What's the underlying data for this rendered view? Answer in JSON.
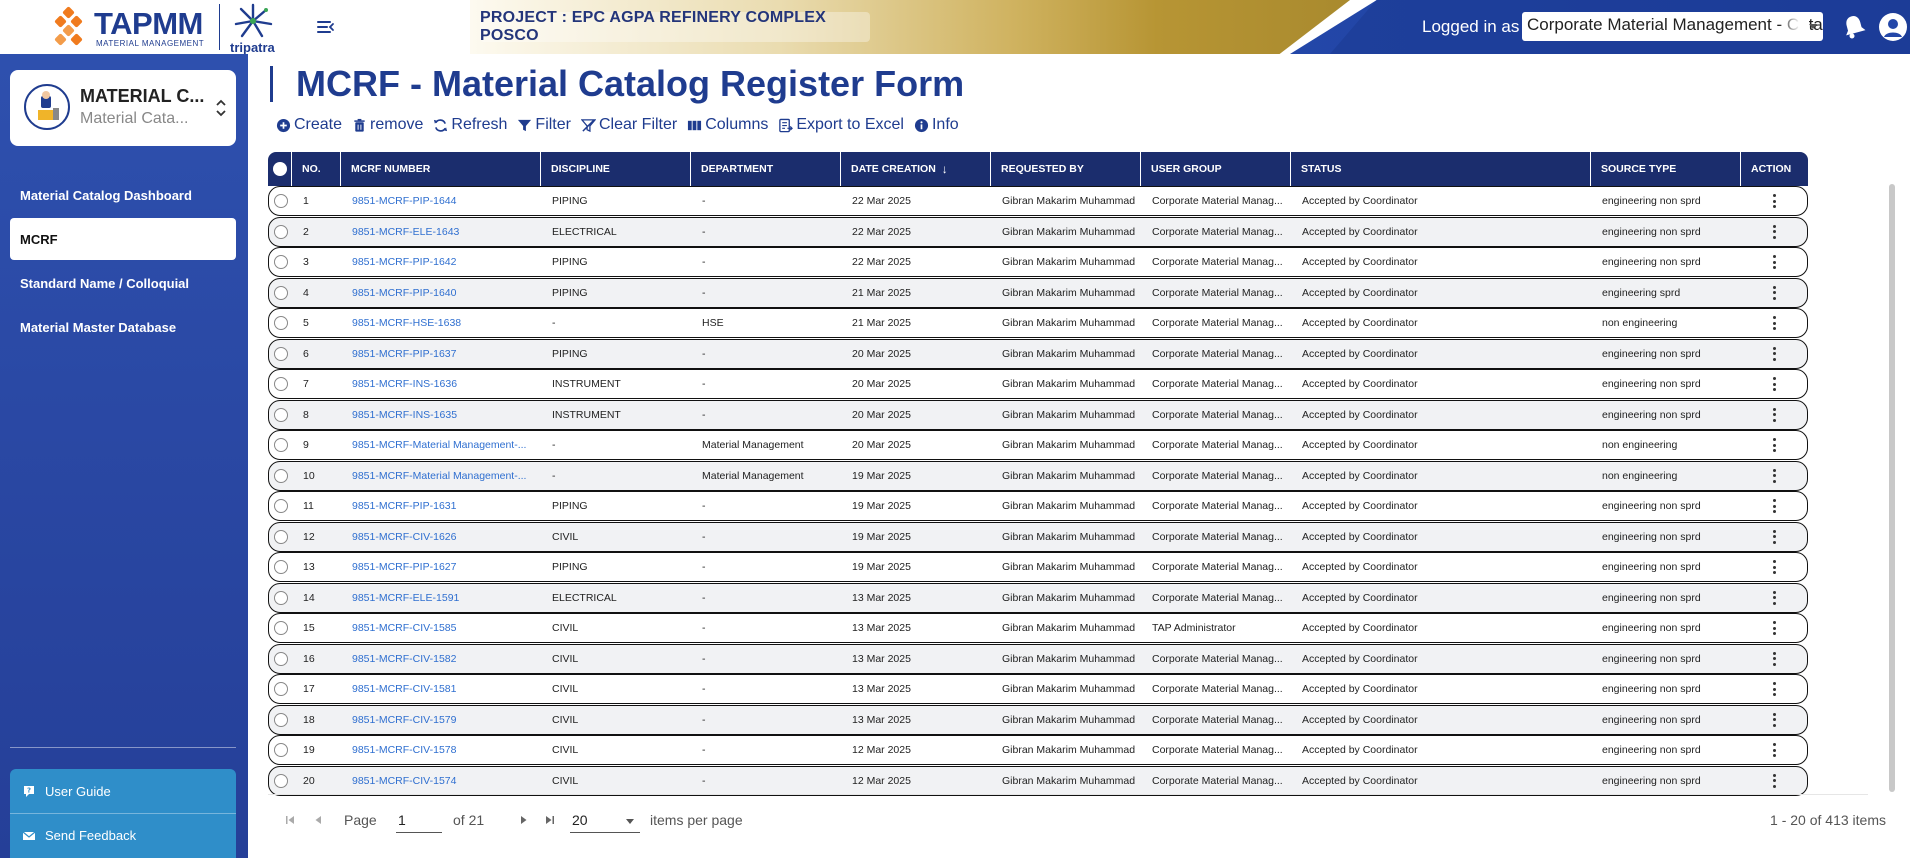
{
  "header": {
    "brand": "TAPMM",
    "brand_sub": "MATERIAL MANAGEMENT",
    "partner": "tripatra",
    "project": "PROJECT : EPC AGPA REFINERY COMPLEX POSCO",
    "logged_in_label": "Logged in as",
    "role": "Corporate Material Management - Catalog"
  },
  "sidebar": {
    "app_title": "MATERIAL C...",
    "app_subtitle": "Material Cata...",
    "items": [
      {
        "label": "Material Catalog Dashboard"
      },
      {
        "label": "MCRF"
      },
      {
        "label": "Standard Name / Colloquial"
      },
      {
        "label": "Material Master Database"
      }
    ],
    "footer": [
      {
        "label": "User Guide"
      },
      {
        "label": "Send Feedback"
      }
    ]
  },
  "main": {
    "title": "MCRF - Material Catalog Register Form",
    "toolbar": {
      "create": "Create",
      "remove": "remove",
      "refresh": "Refresh",
      "filter": "Filter",
      "clear_filter": "Clear Filter",
      "columns": "Columns",
      "export": "Export to Excel",
      "info": "Info"
    }
  },
  "table": {
    "columns": [
      "NO.",
      "MCRF NUMBER",
      "DISCIPLINE",
      "DEPARTMENT",
      "DATE CREATION",
      "REQUESTED BY",
      "USER GROUP",
      "STATUS",
      "SOURCE TYPE",
      "ACTION"
    ],
    "rows": [
      [
        "1",
        "9851-MCRF-PIP-1644",
        "PIPING",
        "-",
        "22 Mar 2025",
        "Gibran Makarim Muhammad",
        "Corporate Material Manag...",
        "Accepted by Coordinator",
        "engineering non sprd"
      ],
      [
        "2",
        "9851-MCRF-ELE-1643",
        "ELECTRICAL",
        "-",
        "22 Mar 2025",
        "Gibran Makarim Muhammad",
        "Corporate Material Manag...",
        "Accepted by Coordinator",
        "engineering non sprd"
      ],
      [
        "3",
        "9851-MCRF-PIP-1642",
        "PIPING",
        "-",
        "22 Mar 2025",
        "Gibran Makarim Muhammad",
        "Corporate Material Manag...",
        "Accepted by Coordinator",
        "engineering non sprd"
      ],
      [
        "4",
        "9851-MCRF-PIP-1640",
        "PIPING",
        "-",
        "21 Mar 2025",
        "Gibran Makarim Muhammad",
        "Corporate Material Manag...",
        "Accepted by Coordinator",
        "engineering sprd"
      ],
      [
        "5",
        "9851-MCRF-HSE-1638",
        "-",
        "HSE",
        "21 Mar 2025",
        "Gibran Makarim Muhammad",
        "Corporate Material Manag...",
        "Accepted by Coordinator",
        "non engineering"
      ],
      [
        "6",
        "9851-MCRF-PIP-1637",
        "PIPING",
        "-",
        "20 Mar 2025",
        "Gibran Makarim Muhammad",
        "Corporate Material Manag...",
        "Accepted by Coordinator",
        "engineering non sprd"
      ],
      [
        "7",
        "9851-MCRF-INS-1636",
        "INSTRUMENT",
        "-",
        "20 Mar 2025",
        "Gibran Makarim Muhammad",
        "Corporate Material Manag...",
        "Accepted by Coordinator",
        "engineering non sprd"
      ],
      [
        "8",
        "9851-MCRF-INS-1635",
        "INSTRUMENT",
        "-",
        "20 Mar 2025",
        "Gibran Makarim Muhammad",
        "Corporate Material Manag...",
        "Accepted by Coordinator",
        "engineering non sprd"
      ],
      [
        "9",
        "9851-MCRF-Material Management-...",
        "-",
        "Material Management",
        "20 Mar 2025",
        "Gibran Makarim Muhammad",
        "Corporate Material Manag...",
        "Accepted by Coordinator",
        "non engineering"
      ],
      [
        "10",
        "9851-MCRF-Material Management-...",
        "-",
        "Material Management",
        "19 Mar 2025",
        "Gibran Makarim Muhammad",
        "Corporate Material Manag...",
        "Accepted by Coordinator",
        "non engineering"
      ],
      [
        "11",
        "9851-MCRF-PIP-1631",
        "PIPING",
        "-",
        "19 Mar 2025",
        "Gibran Makarim Muhammad",
        "Corporate Material Manag...",
        "Accepted by Coordinator",
        "engineering non sprd"
      ],
      [
        "12",
        "9851-MCRF-CIV-1626",
        "CIVIL",
        "-",
        "19 Mar 2025",
        "Gibran Makarim Muhammad",
        "Corporate Material Manag...",
        "Accepted by Coordinator",
        "engineering non sprd"
      ],
      [
        "13",
        "9851-MCRF-PIP-1627",
        "PIPING",
        "-",
        "19 Mar 2025",
        "Gibran Makarim Muhammad",
        "Corporate Material Manag...",
        "Accepted by Coordinator",
        "engineering non sprd"
      ],
      [
        "14",
        "9851-MCRF-ELE-1591",
        "ELECTRICAL",
        "-",
        "13 Mar 2025",
        "Gibran Makarim Muhammad",
        "Corporate Material Manag...",
        "Accepted by Coordinator",
        "engineering non sprd"
      ],
      [
        "15",
        "9851-MCRF-CIV-1585",
        "CIVIL",
        "-",
        "13 Mar 2025",
        "Gibran Makarim Muhammad",
        "TAP Administrator",
        "Accepted by Coordinator",
        "engineering non sprd"
      ],
      [
        "16",
        "9851-MCRF-CIV-1582",
        "CIVIL",
        "-",
        "13 Mar 2025",
        "Gibran Makarim Muhammad",
        "Corporate Material Manag...",
        "Accepted by Coordinator",
        "engineering non sprd"
      ],
      [
        "17",
        "9851-MCRF-CIV-1581",
        "CIVIL",
        "-",
        "13 Mar 2025",
        "Gibran Makarim Muhammad",
        "Corporate Material Manag...",
        "Accepted by Coordinator",
        "engineering non sprd"
      ],
      [
        "18",
        "9851-MCRF-CIV-1579",
        "CIVIL",
        "-",
        "13 Mar 2025",
        "Gibran Makarim Muhammad",
        "Corporate Material Manag...",
        "Accepted by Coordinator",
        "engineering non sprd"
      ],
      [
        "19",
        "9851-MCRF-CIV-1578",
        "CIVIL",
        "-",
        "12 Mar 2025",
        "Gibran Makarim Muhammad",
        "Corporate Material Manag...",
        "Accepted by Coordinator",
        "engineering non sprd"
      ],
      [
        "20",
        "9851-MCRF-CIV-1574",
        "CIVIL",
        "-",
        "12 Mar 2025",
        "Gibran Makarim Muhammad",
        "Corporate Material Manag...",
        "Accepted by Coordinator",
        "engineering non sprd"
      ]
    ]
  },
  "pager": {
    "page_label": "Page",
    "page": "1",
    "of_label": "of 21",
    "page_size": "20",
    "per_page_label": "items per page",
    "range": "1 - 20 of 413 items"
  },
  "colors": {
    "brand_blue": "#1f3c8f",
    "brand_orange": "#f07b1e",
    "header_dark": "#1b2d6d",
    "link": "#2f6fd0"
  }
}
